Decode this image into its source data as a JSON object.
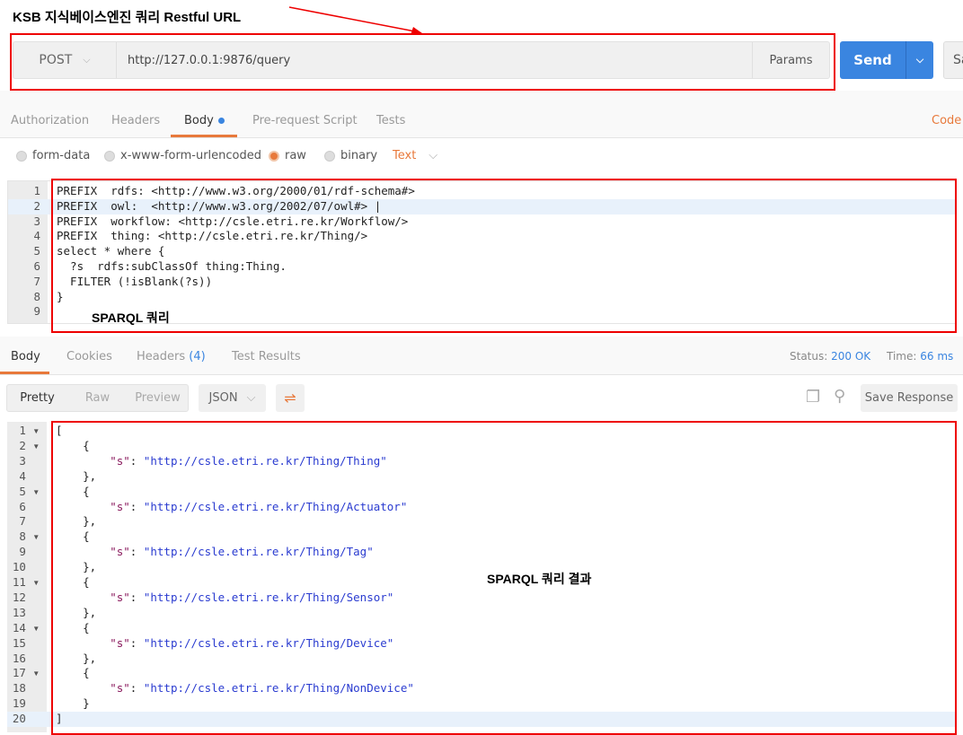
{
  "annotations": {
    "url_label": "KSB 지식베이스엔진 쿼리 Restful URL",
    "query_label": "SPARQL 쿼리",
    "result_label": "SPARQL 쿼리 결과"
  },
  "request": {
    "method": "POST",
    "url": "http://127.0.0.1:9876/query",
    "params": "Params",
    "send": "Send",
    "save": "Sa"
  },
  "request_tabs": [
    "Authorization",
    "Headers",
    "Body",
    "Pre-request Script",
    "Tests"
  ],
  "code_link": "Code",
  "body_types": [
    "form-data",
    "x-www-form-urlencoded",
    "raw",
    "binary"
  ],
  "body_format": "Text",
  "query_lines": [
    "PREFIX  rdfs: <http://www.w3.org/2000/01/rdf-schema#>",
    "PREFIX  owl:  <http://www.w3.org/2002/07/owl#> |",
    "PREFIX  workflow: <http://csle.etri.re.kr/Workflow/>",
    "PREFIX  thing: <http://csle.etri.re.kr/Thing/>",
    "select * where {",
    "  ?s  rdfs:subClassOf thing:Thing.",
    "  FILTER (!isBlank(?s))",
    "}",
    ""
  ],
  "response_tabs": {
    "body": "Body",
    "cookies": "Cookies",
    "headers": "Headers",
    "headers_count": "(4)",
    "tests": "Test Results"
  },
  "status": {
    "status_label": "Status:",
    "status_value": "200 OK",
    "time_label": "Time:",
    "time_value": "66 ms"
  },
  "view_modes": [
    "Pretty",
    "Raw",
    "Preview"
  ],
  "response_format": "JSON",
  "save_response": "Save Response",
  "response_values": [
    "http://csle.etri.re.kr/Thing/Thing",
    "http://csle.etri.re.kr/Thing/Actuator",
    "http://csle.etri.re.kr/Thing/Tag",
    "http://csle.etri.re.kr/Thing/Sensor",
    "http://csle.etri.re.kr/Thing/Device",
    "http://csle.etri.re.kr/Thing/NonDevice"
  ],
  "response_key": "\"s\""
}
